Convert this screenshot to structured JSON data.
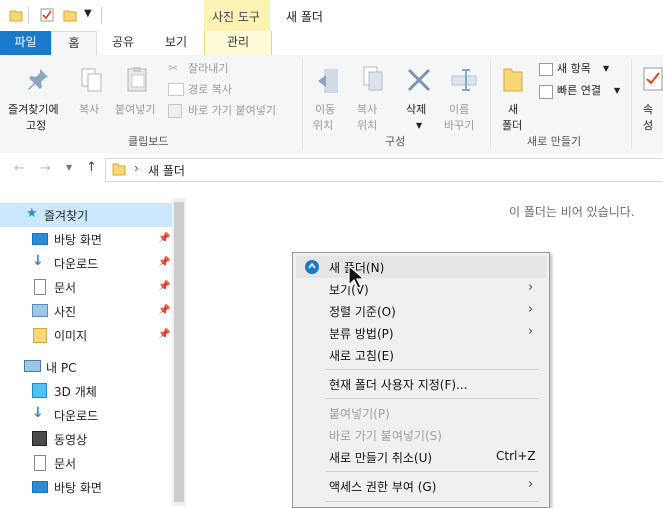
{
  "titlebar": {
    "tool_tab": "사진 도구",
    "title": "새 폴더"
  },
  "tabs": {
    "file": "파일",
    "home": "홈",
    "share": "공유",
    "view": "보기",
    "manage": "관리"
  },
  "ribbon": {
    "pin_label_1": "즐겨찾기에",
    "pin_label_2": "고정",
    "copy": "복사",
    "paste": "붙여넣기",
    "cut": "잘라내기",
    "copy_path": "경로 복사",
    "paste_shortcut": "바로 가기 붙여넣기",
    "clipboard_group": "클립보드",
    "move_1": "이동",
    "move_2": "위치",
    "copyto_1": "복사",
    "copyto_2": "위치",
    "delete": "삭제",
    "rename_1": "이름",
    "rename_2": "바꾸기",
    "organize_group": "구성",
    "new_folder_1": "새",
    "new_folder_2": "폴더",
    "new_item": "새 항목",
    "easy_access": "빠른 연결",
    "new_group": "새로 만들기",
    "properties": "속성"
  },
  "address": {
    "path": "새 폴더",
    "separator": "›"
  },
  "navpane": {
    "items": [
      {
        "label": "즐겨찾기"
      },
      {
        "label": "바탕 화면"
      },
      {
        "label": "다운로드"
      },
      {
        "label": "문서"
      },
      {
        "label": "사진"
      },
      {
        "label": "이미지"
      },
      {
        "label": "내 PC"
      },
      {
        "label": "3D 개체"
      },
      {
        "label": "다운로드"
      },
      {
        "label": "동영상"
      },
      {
        "label": "문서"
      },
      {
        "label": "바탕 화면"
      }
    ]
  },
  "content": {
    "empty_message": "이 폴더는 비어 있습니다."
  },
  "context_menu": {
    "items": [
      {
        "label": "새 폴더(N)"
      },
      {
        "label": "보기(V)"
      },
      {
        "label": "정렬 기준(O)"
      },
      {
        "label": "분류 방법(P)"
      },
      {
        "label": "새로 고침(E)"
      },
      {
        "label": "현재 폴더 사용자 지정(F)..."
      },
      {
        "label": "붙여넣기(P)"
      },
      {
        "label": "바로 가기 붙여넣기(S)"
      },
      {
        "label": "새로 만들기 취소(U)",
        "shortcut": "Ctrl+Z"
      },
      {
        "label": "액세스 권한 부여 (G)"
      }
    ]
  },
  "colors": {
    "file_tab": "#1979ca",
    "tool_tab": "#fbf3b3",
    "selected_nav": "#cce8ff",
    "folder": "#f8d775"
  }
}
